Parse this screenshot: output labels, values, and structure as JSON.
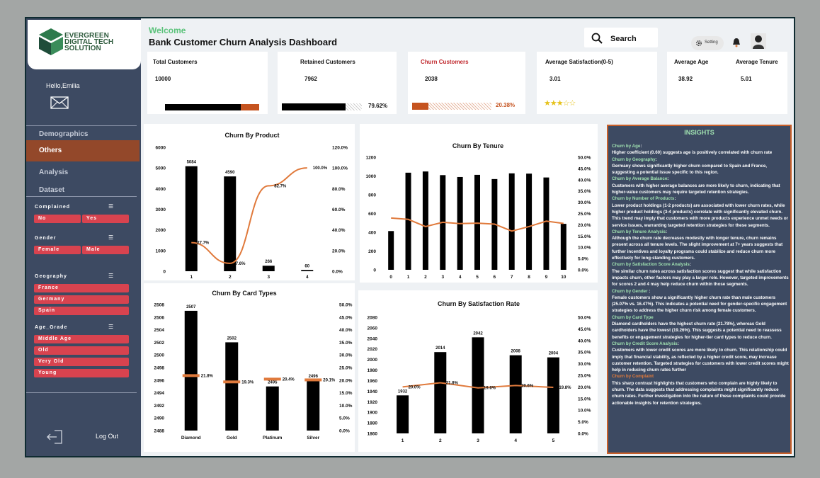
{
  "logo": {
    "line1": "EVERGREEN",
    "line2": "DIGITAL TECH",
    "line3": "SOLUTION"
  },
  "sidebar": {
    "greeting": "Hello,Emilia",
    "nav": [
      {
        "label": "Demographics",
        "active": false
      },
      {
        "label": "Others",
        "active": true
      },
      {
        "label": "Analysis",
        "active": false
      },
      {
        "label": "Dataset",
        "active": false
      }
    ],
    "slicers": [
      {
        "title": "Complained",
        "items": [
          "No",
          "Yes"
        ]
      },
      {
        "title": "Gender",
        "items": [
          "Female",
          "Male"
        ]
      },
      {
        "title": "Geography",
        "items": [
          "France",
          "Germany",
          "Spain"
        ]
      },
      {
        "title": "Age_Grade",
        "items": [
          "Middle Age",
          "Old",
          "Very Old",
          "Young"
        ]
      }
    ],
    "logout": "Log Out"
  },
  "header": {
    "welcome": "Welcome",
    "title": "Bank Customer Churn Analysis Dashboard",
    "search": "Search",
    "setting": "Setting"
  },
  "kpis": {
    "total": {
      "label": "Total Customers",
      "value": "10000"
    },
    "retained": {
      "label": "Retained Customers",
      "value": "7962",
      "pct": "79.62%",
      "fraction": 0.7962
    },
    "churn": {
      "label": "Churn Customers",
      "value": "2038",
      "pct": "20.38%",
      "fraction": 0.2038
    },
    "satisfaction": {
      "label": "Average Satisfaction(0-5)",
      "value": "3.01",
      "stars": "★★★☆☆"
    },
    "age": {
      "label": "Average Age",
      "value": "38.92"
    },
    "tenure": {
      "label": "Average Tenure",
      "value": "5.01"
    }
  },
  "colors": {
    "accent": "#e07a3c",
    "sidebar": "#3d4a62",
    "churn_label": "#c0282d",
    "green": "#59c279"
  },
  "chart_data": [
    {
      "type": "bar",
      "title": "Churn By Product",
      "categories": [
        "1",
        "2",
        "3",
        "4"
      ],
      "values": [
        5084,
        4590,
        266,
        60
      ],
      "line_values": [
        27.7,
        7.6,
        82.7,
        100.0
      ],
      "line_labels": [
        "27.7%",
        "7.6%",
        "82.7%",
        "100.0%"
      ],
      "ylim": [
        0,
        6000
      ],
      "yticks": [
        "0",
        "1000",
        "2000",
        "3000",
        "4000",
        "5000",
        "6000"
      ],
      "y2ticks": [
        "0.0%",
        "20.0%",
        "40.0%",
        "60.0%",
        "80.0%",
        "100.0%",
        "120.0%"
      ]
    },
    {
      "type": "bar",
      "title": "Churn By Tenure",
      "categories": [
        "0",
        "1",
        "2",
        "3",
        "4",
        "5",
        "6",
        "7",
        "8",
        "9",
        "10"
      ],
      "values": [
        413,
        1035,
        1048,
        1009,
        989,
        1012,
        967,
        1028,
        1025,
        984,
        490
      ],
      "line_values": [
        23.0,
        22.4,
        19.2,
        21.1,
        20.5,
        20.7,
        20.3,
        17.2,
        19.2,
        21.6,
        20.6
      ],
      "ylim": [
        0,
        1200
      ],
      "yticks": [
        "0",
        "200",
        "400",
        "600",
        "800",
        "1000",
        "1200"
      ],
      "y2ticks": [
        "0.0%",
        "5.0%",
        "10.0%",
        "15.0%",
        "20.0%",
        "25.0%",
        "30.0%",
        "35.0%",
        "40.0%",
        "45.0%",
        "50.0%"
      ]
    },
    {
      "type": "bar",
      "title": "Churn By Card Types",
      "categories": [
        "Diamond",
        "Gold",
        "Platinum",
        "Silver"
      ],
      "values": [
        2507,
        2502,
        2495,
        2496
      ],
      "line_values": [
        21.8,
        19.3,
        20.4,
        20.1
      ],
      "line_labels": [
        "21.8%",
        "19.3%",
        "20.4%",
        "20.1%"
      ],
      "ylim": [
        2488,
        2508
      ],
      "yticks": [
        "2488",
        "2490",
        "2492",
        "2494",
        "2496",
        "2498",
        "2500",
        "2502",
        "2504",
        "2506",
        "2508"
      ],
      "y2ticks": [
        "0.0%",
        "5.0%",
        "10.0%",
        "15.0%",
        "20.0%",
        "25.0%",
        "30.0%",
        "35.0%",
        "40.0%",
        "45.0%",
        "50.0%"
      ]
    },
    {
      "type": "bar",
      "title": "Churn By Satisfaction Rate",
      "categories": [
        "1",
        "2",
        "3",
        "4",
        "5"
      ],
      "values": [
        1932,
        2014,
        2042,
        2008,
        2004
      ],
      "line_values": [
        20.0,
        21.8,
        19.6,
        20.6,
        19.8
      ],
      "line_labels": [
        "20.0%",
        "21.8%",
        "19.6%",
        "20.6%",
        "19.8%"
      ],
      "ylim": [
        1860,
        2080
      ],
      "yticks": [
        "1860",
        "1880",
        "1900",
        "1920",
        "1940",
        "1960",
        "1980",
        "2000",
        "2020",
        "2040",
        "2060",
        "2080"
      ],
      "y2ticks": [
        "0.0%",
        "5.0%",
        "10.0%",
        "15.0%",
        "20.0%",
        "25.0%",
        "30.0%",
        "35.0%",
        "40.0%",
        "45.0%",
        "50.0%"
      ]
    }
  ],
  "insights": {
    "title": "INSIGHTS",
    "sections": [
      {
        "h": "Churn by Age",
        "sep": ":",
        "body": "Higher coefficient (0.60) suggests age is positively correlated with churn rate",
        "orange": false
      },
      {
        "h": "Churn by Geography",
        "sep": ":",
        "body": "Germany shows significantly higher churn compared to Spain and France, suggesting a potential issue specific to this region.",
        "orange": false
      },
      {
        "h": "Churn by Average Balance",
        "sep": ":",
        "body": "Customers with higher average balances are more likely to churn, indicating that higher-value customers may require targeted retention strategies.",
        "orange": false
      },
      {
        "h": "Churn by Number of Products",
        "sep": ":",
        "body": "Lower product holdings (1-2 products) are associated with lower churn rates, while higher product holdings (3-4 products) correlate with significantly elevated churn. This trend may imply that customers with more products experience unmet needs or service issues, warranting targeted retention strategies for these segments.",
        "orange": false
      },
      {
        "h": "Churn by Tenure Analysis",
        "sep": ":",
        "body": "Although the churn rate decreases modestly with longer tenure, churn remains present across all tenure levels. The slight improvement at 7+ years suggests that further incentives and loyalty programs could stabilize and reduce churn more effectively for long-standing customers.",
        "orange": false
      },
      {
        "h": "Churn by Satisfaction Score Analysis",
        "sep": ":",
        "body": "The similar churn rates across satisfaction scores suggest that while satisfaction impacts churn, other factors may play a larger role. However, targeted improvements for scores 2 and 4 may help reduce churn within those segments.",
        "orange": false
      },
      {
        "h": "Churn by Gender",
        "sep": " :",
        "body": "Female customers show a significantly higher churn rate than male customers (25.07% vs. 16.47%). This indicates a potential need for gender-specific engagement strategies to address the higher churn risk among female customers.",
        "orange": false
      },
      {
        "h": "Churn by Card Type",
        "sep": "",
        "body": "Diamond cardholders have the highest churn rate (21.78%), whereas Gold cardholders have the lowest (19.26%). This suggests a potential need to reassess benefits or engagement strategies for higher-tier card types to reduce churn.",
        "orange": false
      },
      {
        "h": "Churn by Credit Score Analysis",
        "sep": ":",
        "body": "Customers with lower credit scores are more likely to churn. This relationship could imply that financial stability, as reflected by a higher credit score, may increase customer retention. Targeted strategies for customers with lower credit scores might help in reducing churn rates further",
        "orange": false
      },
      {
        "h": "Churn by Complaint",
        "sep": "",
        "body": "This sharp contrast highlights that customers who complain are highly likely to churn. The data suggests that addressing complaints might significantly reduce churn rates. Further investigation into the nature of these complaints could provide actionable insights for retention strategies.",
        "orange": true
      }
    ]
  }
}
